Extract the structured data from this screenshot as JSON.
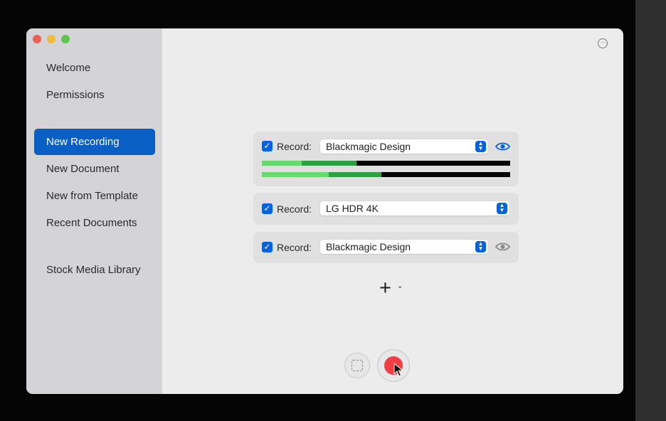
{
  "sidebar": {
    "items": [
      {
        "label": "Welcome"
      },
      {
        "label": "Permissions"
      },
      {
        "label": "New Recording",
        "selected": true
      },
      {
        "label": "New Document"
      },
      {
        "label": "New from Template"
      },
      {
        "label": "Recent Documents"
      },
      {
        "label": "Stock Media Library"
      }
    ]
  },
  "window_controls": [
    "close",
    "minimize",
    "zoom"
  ],
  "main": {
    "more_icon": "ellipsis-circle-icon",
    "sources": [
      {
        "checked": true,
        "label": "Record:",
        "device": "Blackmagic Design",
        "preview_visible": true,
        "has_audio_meters": true
      },
      {
        "checked": true,
        "label": "Record:",
        "device": "LG HDR 4K",
        "preview_visible": false,
        "has_audio_meters": false
      },
      {
        "checked": true,
        "label": "Record:",
        "device": "Blackmagic Design",
        "preview_visible": false,
        "has_audio_meters": false
      }
    ],
    "audio_levels": [
      {
        "level_low": 0.16,
        "level_peak": 0.38
      },
      {
        "level_low": 0.27,
        "level_peak": 0.48
      }
    ],
    "add_source": {
      "icon": "plus-icon",
      "menu_icon": "chevron-down-icon"
    },
    "controls": {
      "select_area_icon": "dashed-rect-icon",
      "record_icon": "record-dot-icon"
    }
  },
  "colors": {
    "accent": "#0a5fc4",
    "record_red": "#f03e44",
    "meter_light_green": "#6ad86a",
    "meter_dark_green": "#2f9f3f"
  }
}
